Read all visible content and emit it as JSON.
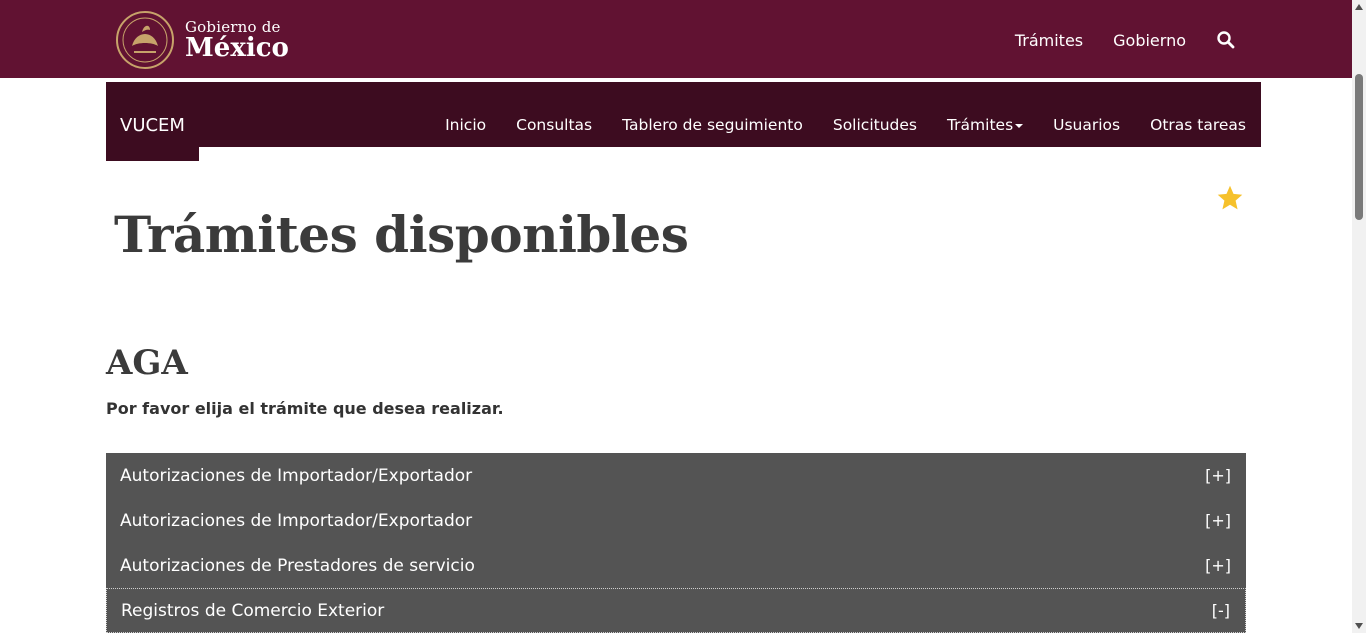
{
  "gov_header": {
    "title_small": "Gobierno de",
    "title_big": "México",
    "nav": [
      "Trámites",
      "Gobierno"
    ]
  },
  "vucem": {
    "brand": "VUCEM",
    "menu": [
      "Inicio",
      "Consultas",
      "Tablero de seguimiento",
      "Solicitudes",
      "Trámites",
      "Usuarios",
      "Otras tareas"
    ]
  },
  "page_title": "Trámites disponibles",
  "section": {
    "title": "AGA",
    "instructions": "Por favor elija el trámite que desea realizar."
  },
  "accordion": [
    {
      "label": "Autorizaciones de Importador/Exportador",
      "toggle": "[+]"
    },
    {
      "label": "Autorizaciones de Importador/Exportador",
      "toggle": "[+]"
    },
    {
      "label": "Autorizaciones de Prestadores de servicio",
      "toggle": "[+]"
    },
    {
      "label": "Registros de Comercio Exterior",
      "toggle": "[-]"
    }
  ],
  "colors": {
    "gov_bar": "#611232",
    "vucem_bar": "#3d0c20",
    "accordion_bg": "#545454",
    "star": "#f6c12b",
    "heading": "#3b3b3b"
  },
  "icons": {
    "logo": "eagle-seal-icon",
    "search": "search-icon",
    "favorite": "star-icon",
    "dropdown": "caret-down-icon"
  }
}
